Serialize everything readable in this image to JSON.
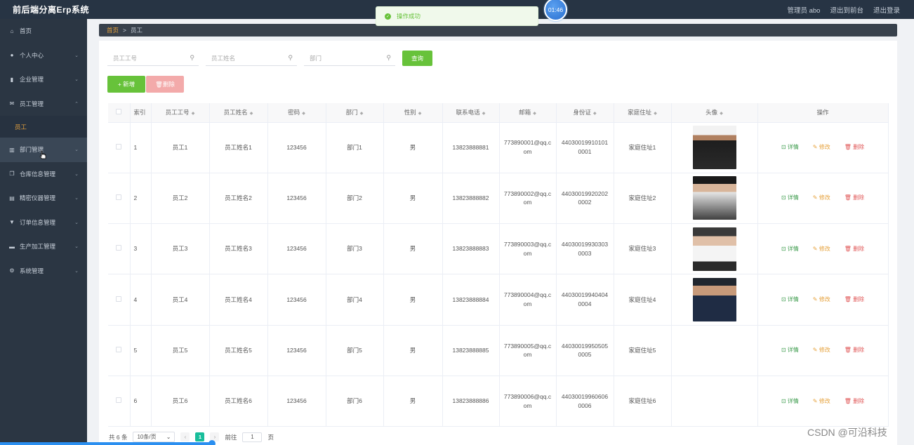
{
  "app": {
    "title": "前后端分离Erp系统"
  },
  "header_links": [
    "管理员 abo",
    "退出到前台",
    "退出登录"
  ],
  "toast": {
    "message": "操作成功"
  },
  "timer": {
    "value": "01:46"
  },
  "sidebar": {
    "items": [
      {
        "label": "首页",
        "icon": "home-icon"
      },
      {
        "label": "个人中心",
        "icon": "user-icon"
      },
      {
        "label": "企业管理",
        "icon": "building-icon"
      },
      {
        "label": "员工管理",
        "icon": "mail-icon",
        "expanded": true
      },
      {
        "label": "员工",
        "sub": true
      },
      {
        "label": "部门管理",
        "icon": "bar-chart-icon",
        "hovered": true
      },
      {
        "label": "仓库信息管理",
        "icon": "copy-icon"
      },
      {
        "label": "精密仪器管理",
        "icon": "device-icon"
      },
      {
        "label": "订单信息管理",
        "icon": "order-icon"
      },
      {
        "label": "生产加工管理",
        "icon": "factory-icon"
      },
      {
        "label": "系统管理",
        "icon": "settings-icon"
      }
    ]
  },
  "breadcrumb": {
    "home": "首页",
    "separator": ">",
    "current": "员工"
  },
  "search": {
    "emp_no_placeholder": "员工工号",
    "emp_name_placeholder": "员工姓名",
    "dept_placeholder": "部门",
    "query_label": "查询"
  },
  "actions": {
    "add_label": "+ 新增",
    "delete_label": "删除"
  },
  "table": {
    "headers": [
      "索引",
      "员工工号",
      "员工姓名",
      "密码",
      "部门",
      "性别",
      "联系电话",
      "邮箱",
      "身份证",
      "家庭住址",
      "头像",
      "操作"
    ],
    "rows": [
      {
        "idx": "1",
        "no": "员工1",
        "name": "员工姓名1",
        "pwd": "123456",
        "dept": "部门1",
        "sex": "男",
        "phone": "13823888881",
        "email": "773890001@qq.com",
        "id": "440300199101010001",
        "addr": "家庭住址1",
        "avatar": "av1"
      },
      {
        "idx": "2",
        "no": "员工2",
        "name": "员工姓名2",
        "pwd": "123456",
        "dept": "部门2",
        "sex": "男",
        "phone": "13823888882",
        "email": "773890002@qq.com",
        "id": "440300199202020002",
        "addr": "家庭住址2",
        "avatar": "av2"
      },
      {
        "idx": "3",
        "no": "员工3",
        "name": "员工姓名3",
        "pwd": "123456",
        "dept": "部门3",
        "sex": "男",
        "phone": "13823888883",
        "email": "773890003@qq.com",
        "id": "440300199303030003",
        "addr": "家庭住址3",
        "avatar": "av3"
      },
      {
        "idx": "4",
        "no": "员工4",
        "name": "员工姓名4",
        "pwd": "123456",
        "dept": "部门4",
        "sex": "男",
        "phone": "13823888884",
        "email": "773890004@qq.com",
        "id": "440300199404040004",
        "addr": "家庭住址4",
        "avatar": "av4"
      },
      {
        "idx": "5",
        "no": "员工5",
        "name": "员工姓名5",
        "pwd": "123456",
        "dept": "部门5",
        "sex": "男",
        "phone": "13823888885",
        "email": "773890005@qq.com",
        "id": "440300199505050005",
        "addr": "家庭住址5",
        "avatar": ""
      },
      {
        "idx": "6",
        "no": "员工6",
        "name": "员工姓名6",
        "pwd": "123456",
        "dept": "部门6",
        "sex": "男",
        "phone": "13823888886",
        "email": "773890006@qq.com",
        "id": "440300199606060006",
        "addr": "家庭住址6",
        "avatar": ""
      }
    ],
    "ops": {
      "detail": "详情",
      "edit": "修改",
      "delete": "删除"
    }
  },
  "pagination": {
    "total": "共 6 条",
    "size": "10条/页",
    "current": "1",
    "goto_label": "前往",
    "goto_value": "1",
    "page_suffix": "页"
  },
  "progress": {
    "fraction": 0.232
  },
  "watermark": "CSDN @可沿科技",
  "colors": {
    "accent": "#67c23a",
    "danger": "#f56c6c",
    "sidebar": "#2b3643",
    "highlight": "#e8a33d"
  }
}
